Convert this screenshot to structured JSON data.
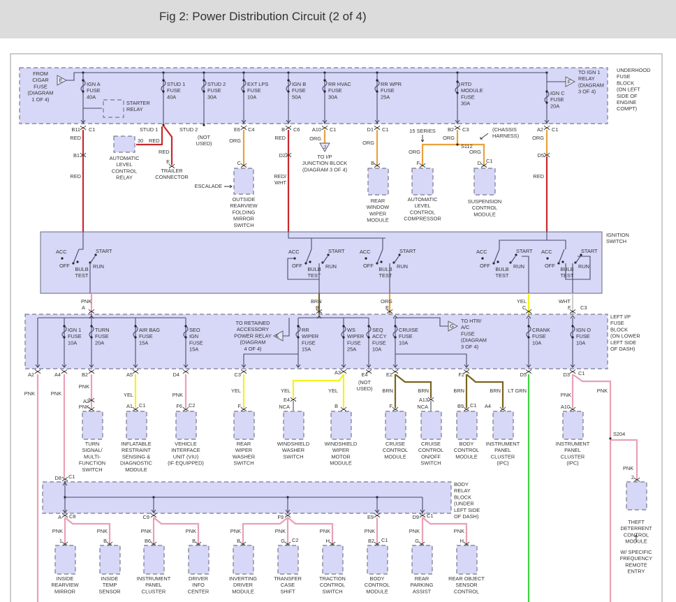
{
  "header": {
    "title": "Fig 2: Power Distribution Circuit (2 of 4)"
  },
  "colors": {
    "header_bg": "#dcdcdc",
    "block_fill": "#d7d7f7",
    "block_border": "#7a7a8a",
    "line": "#4a4a6a",
    "RED": "#c8282c",
    "ORG": "#e9a23b",
    "YEL": "#f2f21e",
    "PNK": "#eaa0b4",
    "BRN": "#7a6420",
    "LT GRN": "#3ed23e",
    "WHT": "#cfcfcf"
  },
  "wire_codes": {
    "red": "RED",
    "org": "ORG",
    "yel": "YEL",
    "pnk": "PNK",
    "brn": "BRN",
    "ltgrn": "LT GRN",
    "wht": "WHT",
    "redwht": [
      "RED/",
      "WHT"
    ]
  },
  "underhood": {
    "block_label": [
      "UNDERHOOD",
      "FUSE",
      "BLOCK",
      "(ON LEFT",
      "SIDE OF",
      "ENGINE",
      "COMPT)"
    ],
    "from_cigar": [
      "FROM",
      "CIGAR",
      "FUSE",
      "(DIAGRAM",
      "1 OF 4)"
    ],
    "tri_e": "E",
    "tri_f": "F",
    "to_ign1": [
      "TO IGN 1",
      "RELAY",
      "(DIAGRAM",
      "3 OF 4)"
    ],
    "fuses": {
      "ign_a": [
        "IGN A",
        "FUSE",
        "40A"
      ],
      "stud1": [
        "STUD 1",
        "FUSE",
        "40A"
      ],
      "stud2": [
        "STUD 2",
        "FUSE",
        "30A"
      ],
      "ext_lps": [
        "EXT LPS",
        "FUSE",
        "10A"
      ],
      "ign_b": [
        "IGN B",
        "FUSE",
        "50A"
      ],
      "rr_hvac": [
        "RR HVAC",
        "FUSE",
        "30A"
      ],
      "rr_wpr": [
        "RR WPR",
        "FUSE",
        "25A"
      ],
      "rtd": [
        "RTD",
        "MODULE",
        "FUSE",
        "30A"
      ],
      "ign_c": [
        "IGN C",
        "FUSE",
        "20A"
      ]
    },
    "starter_relay": [
      "STARTER",
      "RELAY"
    ],
    "conn": {
      "b11": "B11",
      "c1": "C1",
      "stud1": "STUD 1",
      "stud2": "STUD 2",
      "not_used": [
        "(NOT",
        "USED)"
      ],
      "e6": "E6",
      "c4": "C4",
      "b": "B",
      "c6": "C6",
      "a10": "A10",
      "d1": "D1",
      "b2": "B2",
      "c3": "C3",
      "a2": "A2",
      "b1": "B1",
      "d2": "D2",
      "d5": "D5",
      "pin30": "30",
      "pin_e": "E",
      "pin_c": "C",
      "pin_b": "B",
      "pin_f": "F",
      "pin_d": "D",
      "s112": "S112",
      "tri_j": "J"
    },
    "alc_relay": [
      "AUTOMATIC",
      "LEVEL",
      "CONTROL",
      "RELAY"
    ],
    "trailer": [
      "TRAILER",
      "CONNECTOR"
    ],
    "escalade": "ESCALADE",
    "mirror": [
      "OUTSIDE",
      "REARVIEW",
      "FOLDING",
      "MIRROR",
      "SWITCH"
    ],
    "junction": [
      "TO I/P",
      "JUNCTION BLOCK",
      "(DIAGRAM 3 OF 4)"
    ],
    "rear_wiper": [
      "REAR",
      "WINDOW",
      "WIPER",
      "MODULE"
    ],
    "series15": "15 SERIES",
    "chassis": [
      "(CHASSIS",
      "HARNESS)"
    ],
    "alc_comp": [
      "AUTOMATIC",
      "LEVEL",
      "CONTROL",
      "COMPRESSOR"
    ],
    "susp": [
      "SUSPENSION",
      "CONTROL",
      "MODULE"
    ]
  },
  "ignition": {
    "label": [
      "IGNITION",
      "SWITCH"
    ],
    "positions": {
      "acc": "ACC",
      "off": "OFF",
      "bulb_test": [
        "BULB",
        "TEST"
      ],
      "start": "START",
      "run": "RUN"
    },
    "outputs": {
      "a": "A",
      "b": "B",
      "e": "E",
      "c": "C",
      "f": "F",
      "c3": "C3"
    }
  },
  "left_ip": {
    "block_label": [
      "LEFT I/P",
      "FUSE",
      "BLOCK",
      "(ON LOWER",
      "LEFT SIDE",
      "OF DASH)"
    ],
    "fuses": {
      "ign1": [
        "IGN 1",
        "FUSE",
        "10A"
      ],
      "turn": [
        "TURN",
        "FUSE",
        "20A"
      ],
      "airbag": [
        "AIR BAG",
        "FUSE",
        "15A"
      ],
      "seo": [
        "SEO",
        "IGN",
        "FUSE",
        "15A"
      ],
      "rr_wiper": [
        "RR",
        "WIPER",
        "FUSE",
        "15A"
      ],
      "ws_wiper": [
        "WS",
        "WIPER",
        "FUSE",
        "25A"
      ],
      "seq_accy": [
        "SEQ",
        "ACCY",
        "FUSE",
        "10A"
      ],
      "cruise": [
        "CRUISE",
        "FUSE",
        "10A"
      ],
      "crank": [
        "CRANK",
        "FUSE",
        "10A"
      ],
      "ign_o": [
        "IGN O",
        "FUSE",
        "10A"
      ]
    },
    "retained": [
      "TO RETAINED",
      "ACCESSORY",
      "POWER RELAY",
      "(DIAGRAM",
      "4 OF 4)"
    ],
    "tri_k": "K",
    "tri_g": "G",
    "htr": [
      "TO HTR/",
      "A/C",
      "FUSE",
      "(DIAGRAM",
      "3 OF 4)"
    ],
    "conn": {
      "a2": "A2",
      "a4": "A4",
      "b2": "B2",
      "a5": "A5",
      "d4": "D4",
      "c3": "C3",
      "a3": "A3",
      "e4": "E4",
      "not_used": [
        "(NOT",
        "USED)"
      ],
      "e2": "E2",
      "f2": "F2",
      "d5": "D5",
      "d3": "D3",
      "c1": "C1",
      "c2": "C2",
      "a1": "A1",
      "f6": "F6",
      "f": "F",
      "nca": "NCA",
      "b": "B",
      "a13": "A13",
      "b9": "B9",
      "a4b": "A4",
      "a10": "A10",
      "s204": "S204",
      "pin2": "2"
    },
    "modules": {
      "turn": [
        "TURN",
        "SIGNAL/",
        "MULTI-",
        "FUNCTION",
        "SWITCH"
      ],
      "inflatable": [
        "INFLATABLE",
        "RESTRAINT",
        "SENSING &",
        "DIAGNOSTIC",
        "MODULE"
      ],
      "viu": [
        "VEHICLE",
        "INTERFACE",
        "UNIT (VIU)",
        "(IF EQUIPPED)"
      ],
      "rear_washer": [
        "REAR",
        "WIPER",
        "WASHER",
        "SWITCH"
      ],
      "ws_washer": [
        "WINDSHIELD",
        "WASHER",
        "SWITCH"
      ],
      "ws_motor": [
        "WINDSHIELD",
        "WIPER",
        "MOTOR",
        "MODULE"
      ],
      "cruise_mod": [
        "CRUISE",
        "CONTROL",
        "MODULE"
      ],
      "cruise_sw": [
        "CRUISE",
        "CONTROL",
        "ON/OFF",
        "SWITCH"
      ],
      "bcm": [
        "BODY",
        "CONTROL",
        "MODULE"
      ],
      "ipc1": [
        "INSTRUMENT",
        "PANEL",
        "CLUSTER",
        "(IPC)"
      ],
      "ipc2": [
        "INSTRUMENT",
        "PANEL",
        "CLUSTER",
        "(IPC)"
      ],
      "theft": [
        "THEFT",
        "DETERRENT",
        "CONTROL",
        "MODULE"
      ],
      "remote": [
        "W/ SPECIFIC",
        "FREQUENCY",
        "REMOTE",
        "ENTRY"
      ]
    }
  },
  "body_relay": {
    "block_label": [
      "BODY",
      "RELAY",
      "BLOCK",
      "(UNDER",
      "LEFT SIDE",
      "OF DASH)"
    ],
    "conn": {
      "d8": "D8",
      "c1": "C1",
      "a": "A",
      "c8": "C8",
      "c9": "C9",
      "f9": "F9",
      "e9": "E9",
      "d9": "D9",
      "c2": "C2",
      "p1": "1",
      "b": "B",
      "b6": "B6",
      "g": "G",
      "h": "H",
      "b2": "B2"
    },
    "modules": [
      [
        "INSIDE",
        "REARVIEW",
        "MIRROR"
      ],
      [
        "INSIDE",
        "TEMP",
        "SENSOR"
      ],
      [
        "INSTRUMENT",
        "PANEL",
        "CLUSTER"
      ],
      [
        "DRIVER",
        "INFO",
        "CENTER"
      ],
      [
        "INVERTING",
        "DRIVER",
        "MODULE"
      ],
      [
        "TRANSFER",
        "CASE",
        "SHIFT"
      ],
      [
        "TRACTION",
        "CONTROL",
        "SWITCH"
      ],
      [
        "BODY",
        "CONTROL",
        "MODULE"
      ],
      [
        "REAR",
        "PARKING",
        "ASSIST"
      ],
      [
        "REAR OBJECT",
        "SENSOR",
        "CONTROL"
      ]
    ]
  }
}
